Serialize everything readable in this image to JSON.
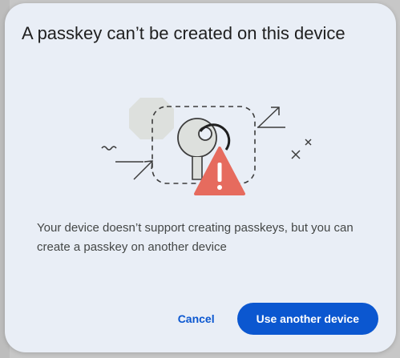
{
  "dialog": {
    "title": "A passkey can’t be created on this device",
    "message": "Your device doesn’t support creating passkeys, but you can create a passkey on another device",
    "cancel_label": "Cancel",
    "primary_label": "Use another device",
    "illustration_icon": "passkey-warning-illustration",
    "accent_color": "#0b57d0",
    "warning_color": "#e66b5e",
    "background_color": "#e9eef6"
  }
}
